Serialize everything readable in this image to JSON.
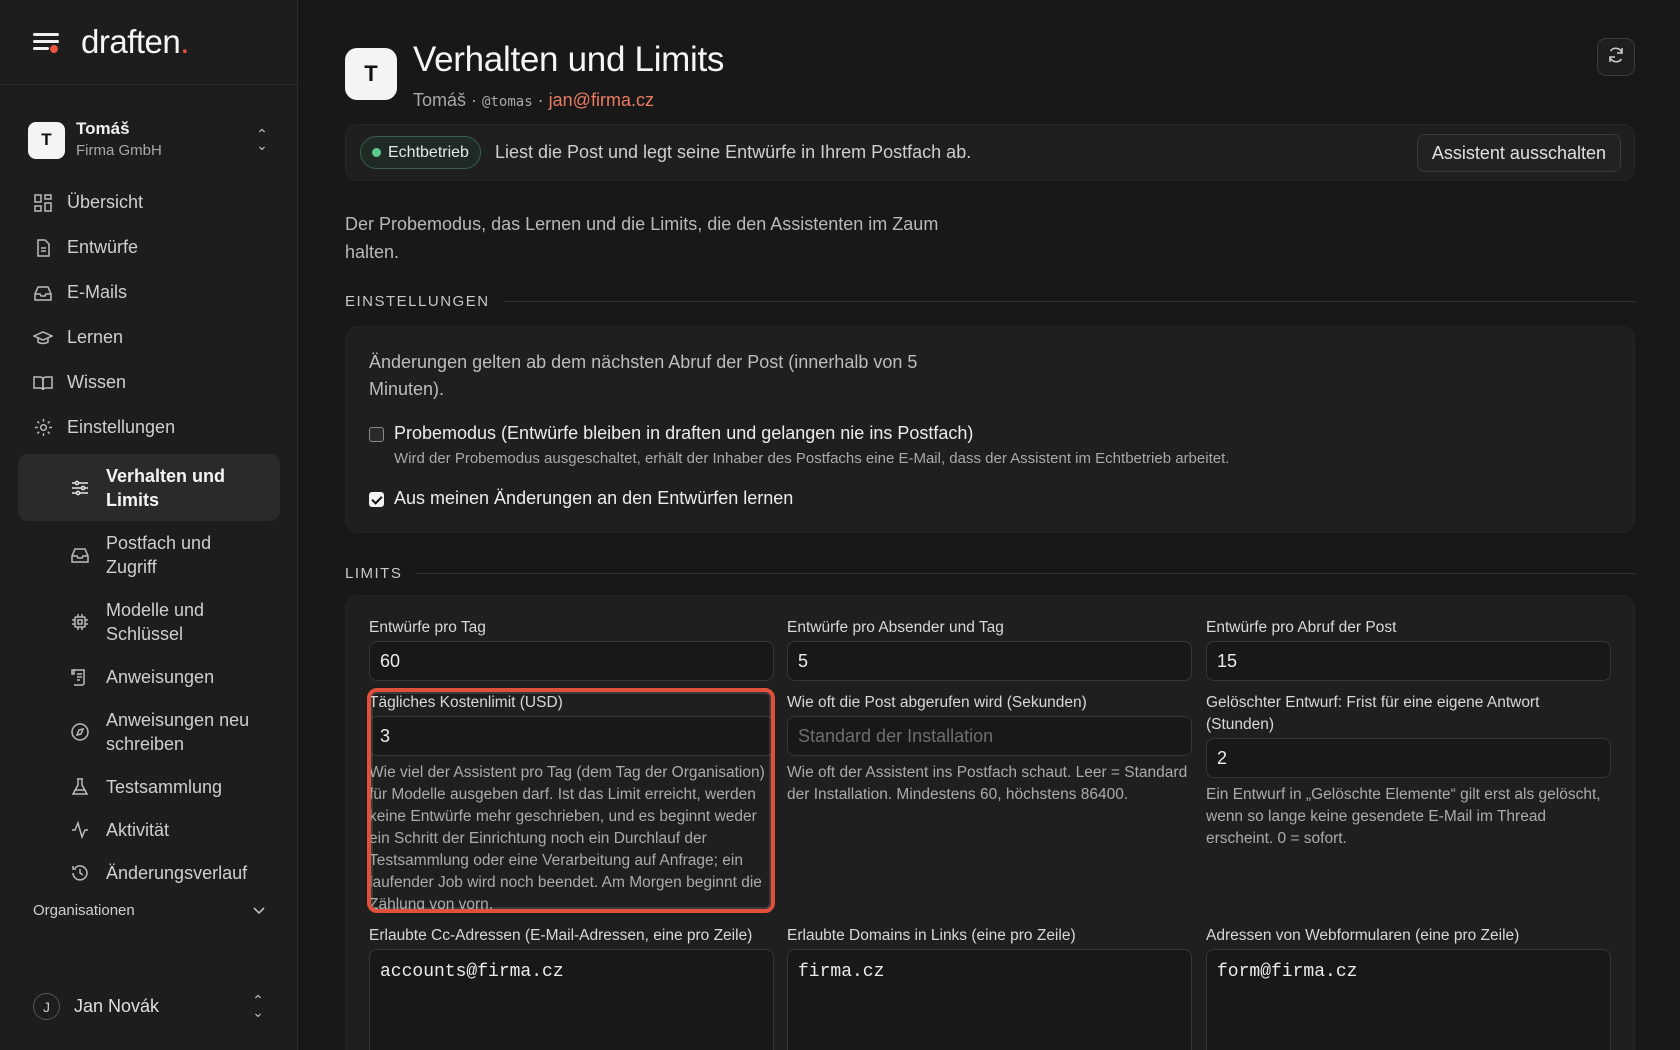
{
  "brand": {
    "name": "draften",
    "dot": "."
  },
  "account": {
    "initial": "T",
    "name": "Tomáš",
    "org": "Firma GmbH"
  },
  "nav": {
    "overview": "Übersicht",
    "drafts": "Entwürfe",
    "emails": "E-Mails",
    "learn": "Lernen",
    "knowledge": "Wissen",
    "settings": "Einstellungen",
    "sub": {
      "behavior": "Verhalten und Limits",
      "mailbox": "Postfach und Zugriff",
      "models": "Modelle und Schlüssel",
      "instructions": "Anweisungen",
      "rewrite": "Anweisungen neu schreiben",
      "testsuite": "Testsammlung",
      "activity": "Aktivität",
      "history": "Änderungsverlauf"
    },
    "organisations": "Organisationen"
  },
  "user": {
    "initial": "J",
    "name": "Jan Novák"
  },
  "header": {
    "initial": "T",
    "title": "Verhalten und Limits",
    "name": "Tomáš",
    "sep": "·",
    "handle": "@tomas",
    "email": "jan@firma.cz"
  },
  "status": {
    "badge": "Echtbetrieb",
    "text": "Liest die Post und legt seine Entwürfe in Ihrem Postfach ab.",
    "button": "Assistent ausschalten",
    "badge_color": "#5cc98f"
  },
  "intro": "Der Probemodus, das Lernen und die Limits, die den Assistenten im Zaum halten.",
  "settings": {
    "title": "EINSTELLUNGEN",
    "note": "Änderungen gelten ab dem nächsten Abruf der Post (innerhalb von 5 Minuten).",
    "trial_label": "Probemodus (Entwürfe bleiben in draften und gelangen nie ins Postfach)",
    "trial_checked": false,
    "trial_help": "Wird der Probemodus ausgeschaltet, erhält der Inhaber des Postfachs eine E-Mail, dass der Assistent im Echtbetrieb arbeitet.",
    "learn_label": "Aus meinen Änderungen an den Entwürfen lernen",
    "learn_checked": true
  },
  "limits": {
    "title": "LIMITS",
    "per_day_label": "Entwürfe pro Tag",
    "per_day_value": "60",
    "per_sender_label": "Entwürfe pro Absender und Tag",
    "per_sender_value": "5",
    "per_fetch_label": "Entwürfe pro Abruf der Post",
    "per_fetch_value": "15",
    "cost_label": "Tägliches Kostenlimit (USD)",
    "cost_value": "3",
    "cost_help": "Wie viel der Assistent pro Tag (dem Tag der Organisation) für Modelle ausgeben darf. Ist das Limit erreicht, werden keine Entwürfe mehr geschrieben, und es beginnt weder ein Schritt der Einrichtung noch ein Durchlauf der Testsammlung oder eine Verarbeitung auf Anfrage; ein laufender Job wird noch beendet. Am Morgen beginnt die Zählung von vorn.",
    "poll_label": "Wie oft die Post abgerufen wird (Sekunden)",
    "poll_placeholder": "Standard der Installation",
    "poll_help": "Wie oft der Assistent ins Postfach schaut. Leer = Standard der Installation. Mindestens 60, höchstens 86400.",
    "deleted_label": "Gelöschter Entwurf: Frist für eine eigene Antwort (Stunden)",
    "deleted_value": "2",
    "deleted_help": "Ein Entwurf in „Gelöschte Elemente“ gilt erst als gelöscht, wenn so lange keine gesendete E-Mail im Thread erscheint. 0 = sofort.",
    "cc_label": "Erlaubte Cc-Adressen (E-Mail-Adressen, eine pro Zeile)",
    "cc_value": "accounts@firma.cz",
    "domains_label": "Erlaubte Domains in Links (eine pro Zeile)",
    "domains_value": "firma.cz",
    "forms_label": "Adressen von Webformularen (eine pro Zeile)",
    "forms_value": "form@firma.cz"
  },
  "colors": {
    "accent": "#e8553e",
    "link": "#e97b62",
    "highlight": "#e0503a"
  }
}
